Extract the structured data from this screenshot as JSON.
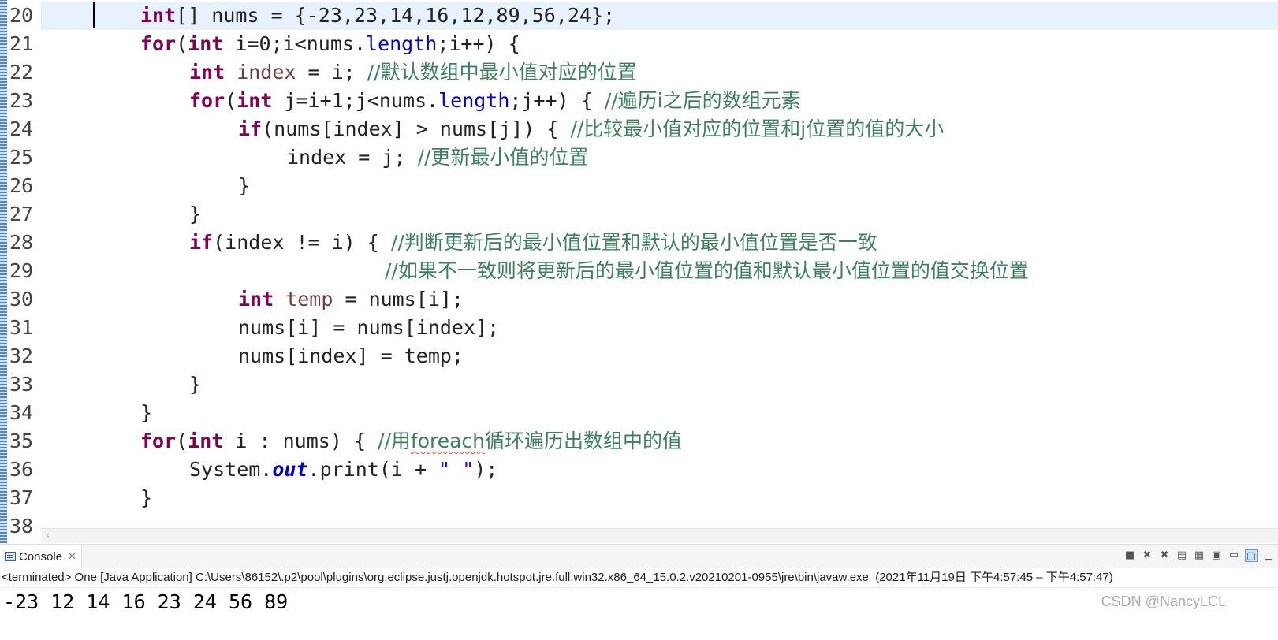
{
  "editor": {
    "line_numbers": [
      "20",
      "21",
      "22",
      "23",
      "24",
      "25",
      "26",
      "27",
      "28",
      "29",
      "30",
      "31",
      "32",
      "33",
      "34",
      "35",
      "36",
      "37",
      "38"
    ],
    "lines": {
      "l20": {
        "kw": "int",
        "rest": "[] nums = {-23,23,14,16,12,89,56,24};"
      },
      "l21": {
        "kw1": "for",
        "p1": "(",
        "kw2": "int",
        "p2": " i=0;i<nums.",
        "fld": "length",
        "p3": ";i++) {"
      },
      "l22": {
        "kw": "int",
        "var": " index",
        "p": " = i; ",
        "cm": "//默认数组中最小值对应的位置"
      },
      "l23": {
        "kw1": "for",
        "p1": "(",
        "kw2": "int",
        "p2": " j=i+1;j<nums.",
        "fld": "length",
        "p3": ";j++) { ",
        "cm": "//遍历i之后的数组元素"
      },
      "l24": {
        "kw": "if",
        "p": "(nums[index] > nums[j]) { ",
        "cm": "//比较最小值对应的位置和j位置的值的大小"
      },
      "l25": {
        "p": "index = j; ",
        "cm": "//更新最小值的位置"
      },
      "l26": {
        "p": "}"
      },
      "l27": {
        "p": "}"
      },
      "l28": {
        "kw": "if",
        "p": "(index != i) { ",
        "cm": "//判断更新后的最小值位置和默认的最小值位置是否一致"
      },
      "l29": {
        "cm": "//如果不一致则将更新后的最小值位置的值和默认最小值位置的值交换位置"
      },
      "l30": {
        "kw": "int",
        "var": " temp",
        "p": " = nums[i];"
      },
      "l31": {
        "p": "nums[i] = nums[index];"
      },
      "l32": {
        "p": "nums[index] = temp;"
      },
      "l33": {
        "p": "}"
      },
      "l34": {
        "p": "}"
      },
      "l35": {
        "kw1": "for",
        "p1": "(",
        "kw2": "int",
        "p2": " i : nums) { ",
        "cm1": "//用",
        "sq": "foreach",
        "cm2": "循环遍历出数组中的值"
      },
      "l36": {
        "p1": "System.",
        "sfld": "out",
        "p2": ".print(i + ",
        "str": "\" \"",
        "p3": ");"
      },
      "l37": {
        "p": "}"
      }
    }
  },
  "console": {
    "tab_label": "Console",
    "tab_close": "✕",
    "status": "<terminated> One [Java Application] C:\\Users\\86152\\.p2\\pool\\plugins\\org.eclipse.justj.openjdk.hotspot.jre.full.win32.x86_64_15.0.2.v20210201-0955\\jre\\bin\\javaw.exe  (2021年11月19日 下午4:57:45 – 下午4:57:47)",
    "output": "-23 12 14 16 23 24 56 89",
    "toolbar": [
      "stop-icon",
      "remove-launch-icon",
      "remove-all-icon",
      "scroll-lock-icon",
      "word-wrap-icon",
      "pin-icon",
      "display-console-icon",
      "open-console-icon",
      "minimize-icon"
    ]
  },
  "watermark": "CSDN @NancyLCL"
}
